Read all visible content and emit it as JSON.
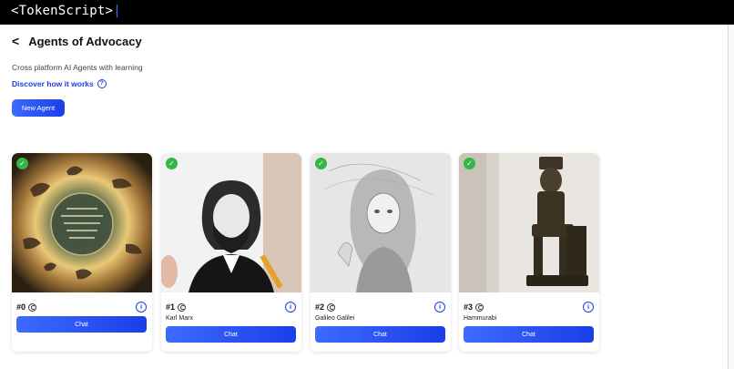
{
  "header": {
    "logo_text": "<TokenScript>",
    "logo_cursor": "|"
  },
  "page": {
    "back_icon": "<",
    "title": "Agents of Advocacy",
    "subtitle": "Cross platform AI Agents with learning",
    "discover_label": "Discover how it works",
    "new_agent_label": "New Agent"
  },
  "colors": {
    "accent": "#1a3ee8",
    "verified": "#33b548",
    "header_bg": "#000000"
  },
  "agents": [
    {
      "number": "#0",
      "name": "",
      "chat_label": "Chat",
      "image": "mystic-tree-artwork"
    },
    {
      "number": "#1",
      "name": "Karl Marx",
      "chat_label": "Chat",
      "image": "karl-marx-sketch"
    },
    {
      "number": "#2",
      "name": "Galileo Galilei",
      "chat_label": "Chat",
      "image": "galileo-sketch"
    },
    {
      "number": "#3",
      "name": "Hammurabi",
      "chat_label": "Chat",
      "image": "hammurabi-statue"
    }
  ]
}
